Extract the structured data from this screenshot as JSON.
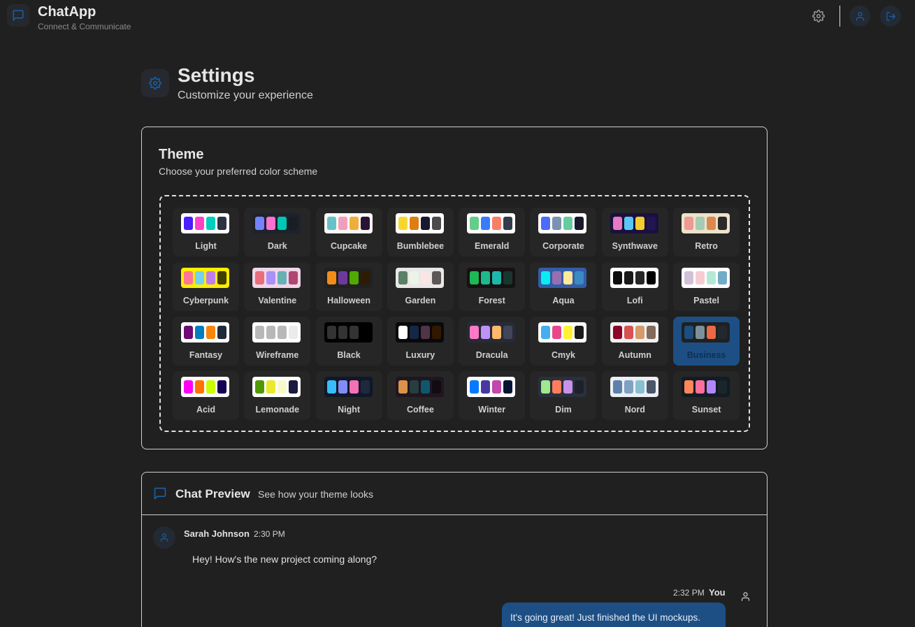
{
  "app": {
    "title": "ChatApp",
    "subtitle": "Connect & Communicate"
  },
  "page": {
    "title": "Settings",
    "subtitle": "Customize your experience"
  },
  "theme_section": {
    "title": "Theme",
    "subtitle": "Choose your preferred color scheme",
    "selected": "Business"
  },
  "themes": [
    {
      "name": "Light",
      "bg": "#ffffff",
      "colors": [
        "#491eff",
        "#ff41c7",
        "#00cfbd",
        "#2b3440"
      ]
    },
    {
      "name": "Dark",
      "bg": "#1d232a",
      "colors": [
        "#7582ff",
        "#ff71cf",
        "#00c7b5",
        "#191e24"
      ]
    },
    {
      "name": "Cupcake",
      "bg": "#faf7f5",
      "colors": [
        "#65c3c8",
        "#ef9fbc",
        "#eeaf3a",
        "#291334"
      ]
    },
    {
      "name": "Bumblebee",
      "bg": "#ffffff",
      "colors": [
        "#f9d72f",
        "#e07d12",
        "#181830",
        "#4b4b4b"
      ]
    },
    {
      "name": "Emerald",
      "bg": "#ffffff",
      "colors": [
        "#66cc8a",
        "#377cfb",
        "#f68067",
        "#333c4d"
      ]
    },
    {
      "name": "Corporate",
      "bg": "#ffffff",
      "colors": [
        "#4b6bfb",
        "#7b92b2",
        "#67cba0",
        "#181a2a"
      ]
    },
    {
      "name": "Synthwave",
      "bg": "#1a103d",
      "colors": [
        "#e779c1",
        "#58c7f3",
        "#f3cc30",
        "#221551"
      ]
    },
    {
      "name": "Retro",
      "bg": "#ece3ca",
      "colors": [
        "#ef9995",
        "#a4cbb4",
        "#dc8850",
        "#2e282a"
      ]
    },
    {
      "name": "Cyberpunk",
      "bg": "#ffee00",
      "colors": [
        "#ff7598",
        "#75d1f0",
        "#c07eec",
        "#423f00"
      ]
    },
    {
      "name": "Valentine",
      "bg": "#f0d6e8",
      "colors": [
        "#e96d7b",
        "#a991f7",
        "#66b1b3",
        "#af4670"
      ]
    },
    {
      "name": "Halloween",
      "bg": "#212121",
      "colors": [
        "#f28c18",
        "#6d3a9c",
        "#51a800",
        "#2f1b05"
      ]
    },
    {
      "name": "Garden",
      "bg": "#e9e7e7",
      "colors": [
        "#5c7f67",
        "#ecf4e7",
        "#fae5e5",
        "#5d5656"
      ]
    },
    {
      "name": "Forest",
      "bg": "#171212",
      "colors": [
        "#1eb854",
        "#1db88e",
        "#1db8ab",
        "#19362d"
      ]
    },
    {
      "name": "Aqua",
      "bg": "#345da7",
      "colors": [
        "#09ecf3",
        "#966fb3",
        "#ffe999",
        "#3b8ac4"
      ]
    },
    {
      "name": "Lofi",
      "bg": "#ffffff",
      "colors": [
        "#0d0d0d",
        "#1a1919",
        "#262626",
        "#000000"
      ]
    },
    {
      "name": "Pastel",
      "bg": "#ffffff",
      "colors": [
        "#d1c1d7",
        "#f6cbd1",
        "#b4e9d6",
        "#70acc7"
      ]
    },
    {
      "name": "Fantasy",
      "bg": "#ffffff",
      "colors": [
        "#6e0b75",
        "#007ebd",
        "#f8860d",
        "#1f2937"
      ]
    },
    {
      "name": "Wireframe",
      "bg": "#ffffff",
      "colors": [
        "#b8b8b8",
        "#b8b8b8",
        "#b8b8b8",
        "#ebebeb"
      ]
    },
    {
      "name": "Black",
      "bg": "#000000",
      "colors": [
        "#343232",
        "#343232",
        "#343232",
        "#000000"
      ]
    },
    {
      "name": "Luxury",
      "bg": "#09090b",
      "colors": [
        "#ffffff",
        "#152747",
        "#513448",
        "#331800"
      ]
    },
    {
      "name": "Dracula",
      "bg": "#282a36",
      "colors": [
        "#ff79c6",
        "#bd93f9",
        "#ffb86c",
        "#414558"
      ]
    },
    {
      "name": "Cmyk",
      "bg": "#ffffff",
      "colors": [
        "#45aeee",
        "#e8488a",
        "#fff232",
        "#1a1a1a"
      ]
    },
    {
      "name": "Autumn",
      "bg": "#f1f1f1",
      "colors": [
        "#8c0327",
        "#d85251",
        "#d59b6a",
        "#826a5c"
      ]
    },
    {
      "name": "Business",
      "bg": "#202020",
      "colors": [
        "#1c4e80",
        "#7c909a",
        "#ea6947",
        "#23282e"
      ]
    },
    {
      "name": "Acid",
      "bg": "#fafafa",
      "colors": [
        "#ff00f4",
        "#ff7400",
        "#cbfd03",
        "#140152"
      ]
    },
    {
      "name": "Lemonade",
      "bg": "#ffffff",
      "colors": [
        "#519903",
        "#e9e92e",
        "#f7f9ca",
        "#191a3e"
      ]
    },
    {
      "name": "Night",
      "bg": "#0f1729",
      "colors": [
        "#38bdf8",
        "#818cf8",
        "#f471b5",
        "#1e293b"
      ]
    },
    {
      "name": "Coffee",
      "bg": "#20161f",
      "colors": [
        "#db924b",
        "#263e3f",
        "#10576d",
        "#120c12"
      ]
    },
    {
      "name": "Winter",
      "bg": "#ffffff",
      "colors": [
        "#047aff",
        "#463aa2",
        "#c148ac",
        "#021431"
      ]
    },
    {
      "name": "Dim",
      "bg": "#2a303c",
      "colors": [
        "#9fe88d",
        "#ff7d5c",
        "#c792e9",
        "#1c212b"
      ]
    },
    {
      "name": "Nord",
      "bg": "#eceff4",
      "colors": [
        "#5e81ac",
        "#81a1c1",
        "#88c0d0",
        "#4c566a"
      ]
    },
    {
      "name": "Sunset",
      "bg": "#121c22",
      "colors": [
        "#ff865b",
        "#fd6f9c",
        "#b387fa",
        "#1b262c"
      ]
    }
  ],
  "preview": {
    "title": "Chat Preview",
    "subtitle": "See how your theme looks",
    "messages": [
      {
        "sender": "Sarah Johnson",
        "time": "2:30 PM",
        "text": "Hey! How's the new project coming along?"
      },
      {
        "sender": "You",
        "time": "2:32 PM",
        "text": "It's going great! Just finished the UI mockups."
      }
    ]
  },
  "colors": {
    "accent": "#1d4f85",
    "background": "#202020",
    "tile": "#262626"
  }
}
